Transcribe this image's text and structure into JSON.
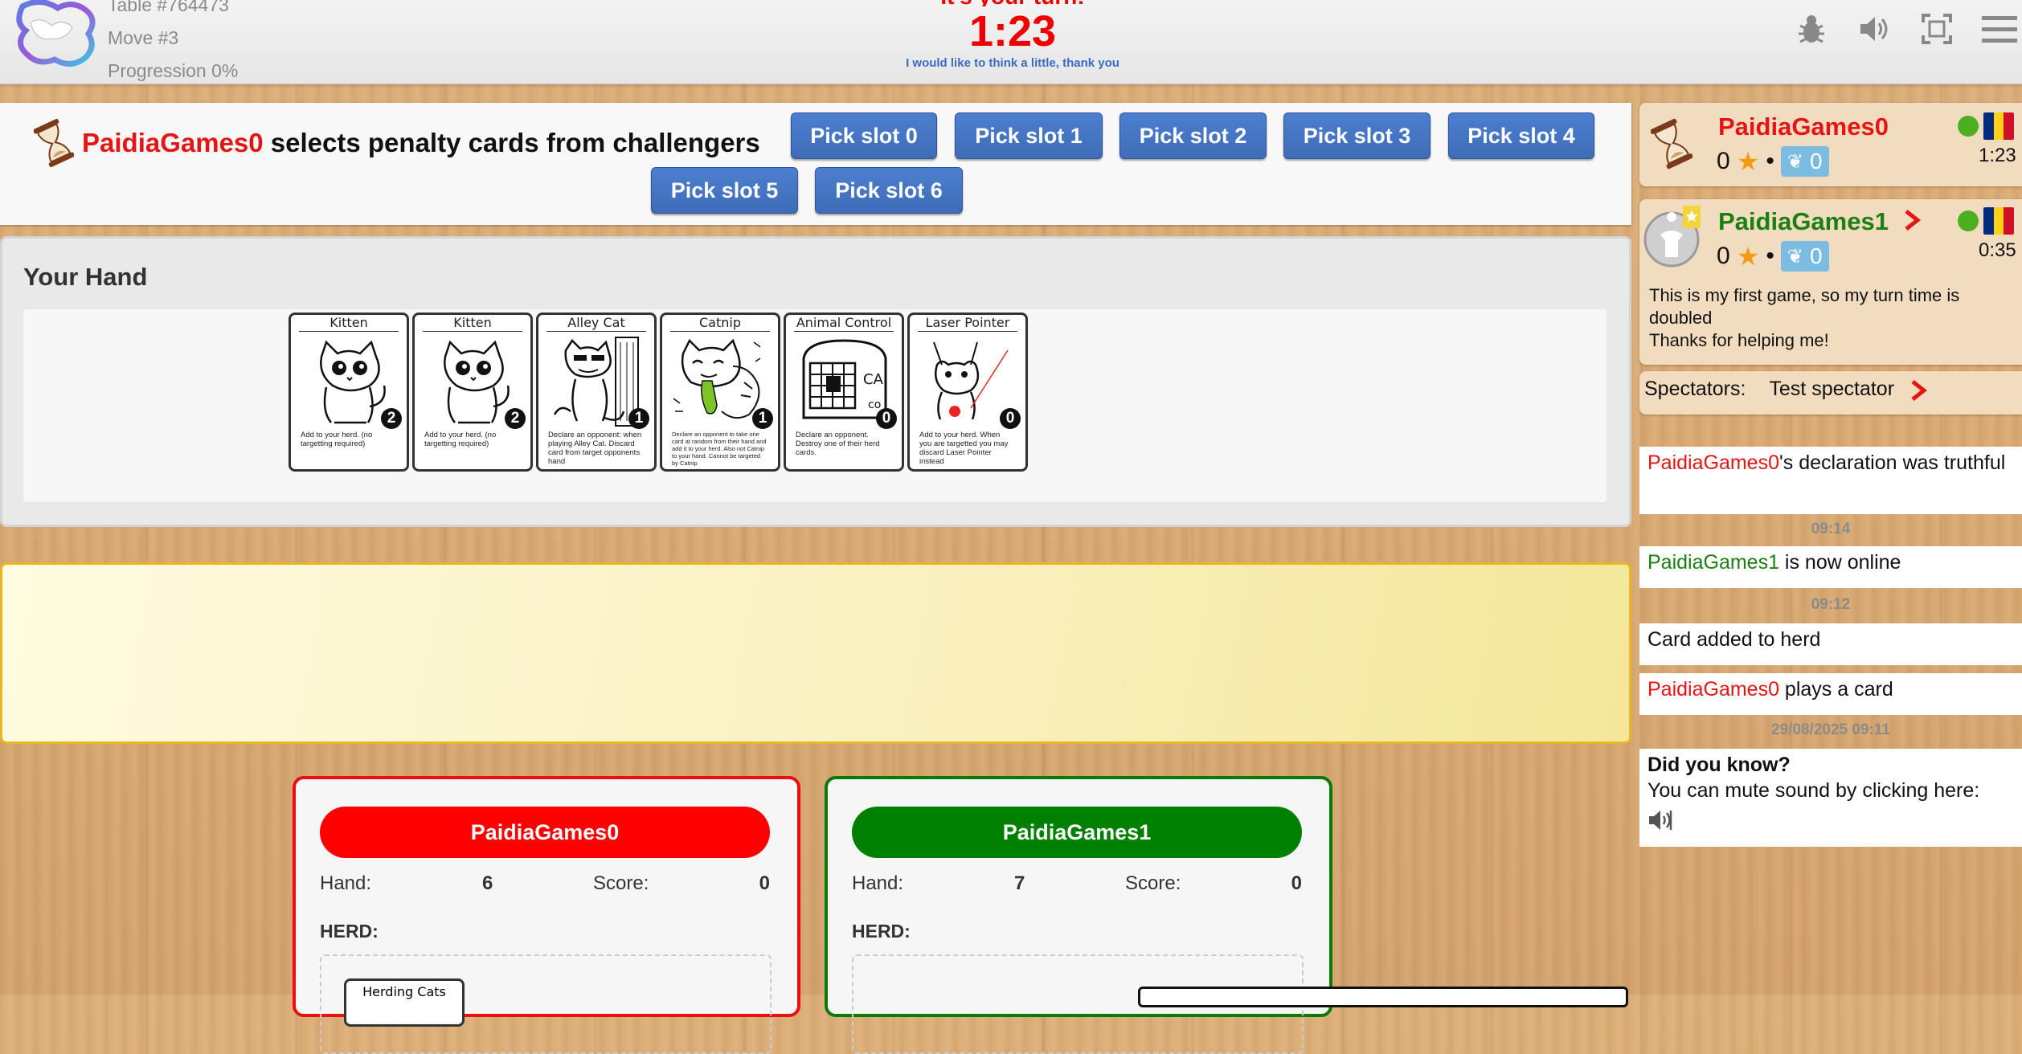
{
  "topbar": {
    "table_id": "Table #764473",
    "move": "Move #3",
    "progression": "Progression 0%",
    "turn_banner": "It's your turn!",
    "timer": "1:23",
    "think_link": "I would like to think a little, thank you",
    "icons": [
      "bug-icon",
      "sound-icon",
      "fullscreen-icon",
      "menu-icon"
    ]
  },
  "action": {
    "player": "PaidiaGames0",
    "text": " selects penalty cards from challengers",
    "buttons": [
      "Pick slot 0",
      "Pick slot 1",
      "Pick slot 2",
      "Pick slot 3",
      "Pick slot 4",
      "Pick slot 5",
      "Pick slot 6"
    ]
  },
  "hand": {
    "title": "Your Hand",
    "cards": [
      {
        "name": "Kitten",
        "value": "2",
        "desc": "Add to your herd. (no targetting required)"
      },
      {
        "name": "Kitten",
        "value": "2",
        "desc": "Add to your herd. (no targetting required)"
      },
      {
        "name": "Alley Cat",
        "value": "1",
        "desc": "Declare an opponent: when playing Alley Cat. Discard card from target opponents hand"
      },
      {
        "name": "Catnip",
        "value": "1",
        "desc": "Declare an opponent to take one card at random from their hand and add it to your herd. Also not Catnip to your hand. Cannot be targeted by Catnip"
      },
      {
        "name": "Animal Control",
        "value": "0",
        "desc": "Declare an opponent. Destroy one of their herd cards."
      },
      {
        "name": "Laser Pointer",
        "value": "0",
        "desc": "Add to your herd. When you are targetted you may discard Laser Pointer instead"
      }
    ]
  },
  "boards": [
    {
      "name": "PaidiaGames0",
      "color": "#ff0000",
      "hand_label": "Hand:",
      "hand": "6",
      "score_label": "Score:",
      "score": "0",
      "herd_label": "HERD:",
      "herd_card": "Herding Cats"
    },
    {
      "name": "PaidiaGames1",
      "color": "#008000",
      "hand_label": "Hand:",
      "hand": "7",
      "score_label": "Score:",
      "score": "0",
      "herd_label": "HERD:",
      "herd_card": ""
    }
  ],
  "players": [
    {
      "name": "PaidiaGames0",
      "score": "0",
      "laurels": "0",
      "time": "1:23",
      "color": "#e41515"
    },
    {
      "name": "PaidiaGames1",
      "score": "0",
      "laurels": "0",
      "time": "0:35",
      "color": "#1b7f12",
      "message_1": "This is my first game, so my turn time is doubled",
      "message_2": "Thanks for helping me!"
    }
  ],
  "spectators": {
    "label": "Spectators:",
    "name": "Test spectator"
  },
  "log": {
    "entry1_player": "PaidiaGames0",
    "entry1_text": "'s declaration was truthful",
    "time1": "09:14",
    "entry2_player": "PaidiaGames1",
    "entry2_text": " is now online",
    "time2": "09:12",
    "entry3_text": "Card added to herd",
    "entry4_player": "PaidiaGames0",
    "entry4_text": " plays a card",
    "time3": "29/08/2025 09:11",
    "tip_title": "Did you know?",
    "tip_text": "You can mute sound by clicking here:"
  }
}
